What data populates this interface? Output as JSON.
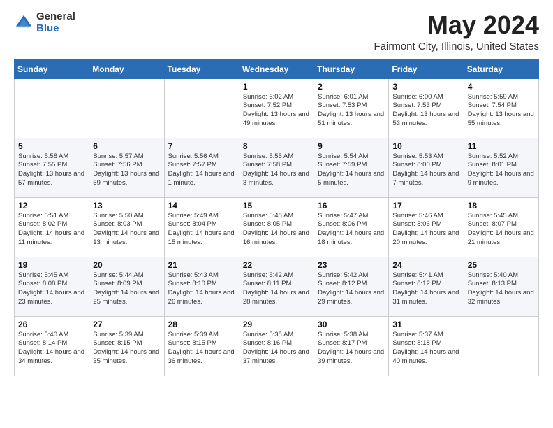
{
  "header": {
    "logo_general": "General",
    "logo_blue": "Blue",
    "title": "May 2024",
    "subtitle": "Fairmont City, Illinois, United States"
  },
  "days_of_week": [
    "Sunday",
    "Monday",
    "Tuesday",
    "Wednesday",
    "Thursday",
    "Friday",
    "Saturday"
  ],
  "weeks": [
    [
      {
        "day": "",
        "sunrise": "",
        "sunset": "",
        "daylight": ""
      },
      {
        "day": "",
        "sunrise": "",
        "sunset": "",
        "daylight": ""
      },
      {
        "day": "",
        "sunrise": "",
        "sunset": "",
        "daylight": ""
      },
      {
        "day": "1",
        "sunrise": "Sunrise: 6:02 AM",
        "sunset": "Sunset: 7:52 PM",
        "daylight": "Daylight: 13 hours and 49 minutes."
      },
      {
        "day": "2",
        "sunrise": "Sunrise: 6:01 AM",
        "sunset": "Sunset: 7:53 PM",
        "daylight": "Daylight: 13 hours and 51 minutes."
      },
      {
        "day": "3",
        "sunrise": "Sunrise: 6:00 AM",
        "sunset": "Sunset: 7:53 PM",
        "daylight": "Daylight: 13 hours and 53 minutes."
      },
      {
        "day": "4",
        "sunrise": "Sunrise: 5:59 AM",
        "sunset": "Sunset: 7:54 PM",
        "daylight": "Daylight: 13 hours and 55 minutes."
      }
    ],
    [
      {
        "day": "5",
        "sunrise": "Sunrise: 5:58 AM",
        "sunset": "Sunset: 7:55 PM",
        "daylight": "Daylight: 13 hours and 57 minutes."
      },
      {
        "day": "6",
        "sunrise": "Sunrise: 5:57 AM",
        "sunset": "Sunset: 7:56 PM",
        "daylight": "Daylight: 13 hours and 59 minutes."
      },
      {
        "day": "7",
        "sunrise": "Sunrise: 5:56 AM",
        "sunset": "Sunset: 7:57 PM",
        "daylight": "Daylight: 14 hours and 1 minute."
      },
      {
        "day": "8",
        "sunrise": "Sunrise: 5:55 AM",
        "sunset": "Sunset: 7:58 PM",
        "daylight": "Daylight: 14 hours and 3 minutes."
      },
      {
        "day": "9",
        "sunrise": "Sunrise: 5:54 AM",
        "sunset": "Sunset: 7:59 PM",
        "daylight": "Daylight: 14 hours and 5 minutes."
      },
      {
        "day": "10",
        "sunrise": "Sunrise: 5:53 AM",
        "sunset": "Sunset: 8:00 PM",
        "daylight": "Daylight: 14 hours and 7 minutes."
      },
      {
        "day": "11",
        "sunrise": "Sunrise: 5:52 AM",
        "sunset": "Sunset: 8:01 PM",
        "daylight": "Daylight: 14 hours and 9 minutes."
      }
    ],
    [
      {
        "day": "12",
        "sunrise": "Sunrise: 5:51 AM",
        "sunset": "Sunset: 8:02 PM",
        "daylight": "Daylight: 14 hours and 11 minutes."
      },
      {
        "day": "13",
        "sunrise": "Sunrise: 5:50 AM",
        "sunset": "Sunset: 8:03 PM",
        "daylight": "Daylight: 14 hours and 13 minutes."
      },
      {
        "day": "14",
        "sunrise": "Sunrise: 5:49 AM",
        "sunset": "Sunset: 8:04 PM",
        "daylight": "Daylight: 14 hours and 15 minutes."
      },
      {
        "day": "15",
        "sunrise": "Sunrise: 5:48 AM",
        "sunset": "Sunset: 8:05 PM",
        "daylight": "Daylight: 14 hours and 16 minutes."
      },
      {
        "day": "16",
        "sunrise": "Sunrise: 5:47 AM",
        "sunset": "Sunset: 8:06 PM",
        "daylight": "Daylight: 14 hours and 18 minutes."
      },
      {
        "day": "17",
        "sunrise": "Sunrise: 5:46 AM",
        "sunset": "Sunset: 8:06 PM",
        "daylight": "Daylight: 14 hours and 20 minutes."
      },
      {
        "day": "18",
        "sunrise": "Sunrise: 5:45 AM",
        "sunset": "Sunset: 8:07 PM",
        "daylight": "Daylight: 14 hours and 21 minutes."
      }
    ],
    [
      {
        "day": "19",
        "sunrise": "Sunrise: 5:45 AM",
        "sunset": "Sunset: 8:08 PM",
        "daylight": "Daylight: 14 hours and 23 minutes."
      },
      {
        "day": "20",
        "sunrise": "Sunrise: 5:44 AM",
        "sunset": "Sunset: 8:09 PM",
        "daylight": "Daylight: 14 hours and 25 minutes."
      },
      {
        "day": "21",
        "sunrise": "Sunrise: 5:43 AM",
        "sunset": "Sunset: 8:10 PM",
        "daylight": "Daylight: 14 hours and 26 minutes."
      },
      {
        "day": "22",
        "sunrise": "Sunrise: 5:42 AM",
        "sunset": "Sunset: 8:11 PM",
        "daylight": "Daylight: 14 hours and 28 minutes."
      },
      {
        "day": "23",
        "sunrise": "Sunrise: 5:42 AM",
        "sunset": "Sunset: 8:12 PM",
        "daylight": "Daylight: 14 hours and 29 minutes."
      },
      {
        "day": "24",
        "sunrise": "Sunrise: 5:41 AM",
        "sunset": "Sunset: 8:12 PM",
        "daylight": "Daylight: 14 hours and 31 minutes."
      },
      {
        "day": "25",
        "sunrise": "Sunrise: 5:40 AM",
        "sunset": "Sunset: 8:13 PM",
        "daylight": "Daylight: 14 hours and 32 minutes."
      }
    ],
    [
      {
        "day": "26",
        "sunrise": "Sunrise: 5:40 AM",
        "sunset": "Sunset: 8:14 PM",
        "daylight": "Daylight: 14 hours and 34 minutes."
      },
      {
        "day": "27",
        "sunrise": "Sunrise: 5:39 AM",
        "sunset": "Sunset: 8:15 PM",
        "daylight": "Daylight: 14 hours and 35 minutes."
      },
      {
        "day": "28",
        "sunrise": "Sunrise: 5:39 AM",
        "sunset": "Sunset: 8:15 PM",
        "daylight": "Daylight: 14 hours and 36 minutes."
      },
      {
        "day": "29",
        "sunrise": "Sunrise: 5:38 AM",
        "sunset": "Sunset: 8:16 PM",
        "daylight": "Daylight: 14 hours and 37 minutes."
      },
      {
        "day": "30",
        "sunrise": "Sunrise: 5:38 AM",
        "sunset": "Sunset: 8:17 PM",
        "daylight": "Daylight: 14 hours and 39 minutes."
      },
      {
        "day": "31",
        "sunrise": "Sunrise: 5:37 AM",
        "sunset": "Sunset: 8:18 PM",
        "daylight": "Daylight: 14 hours and 40 minutes."
      },
      {
        "day": "",
        "sunrise": "",
        "sunset": "",
        "daylight": ""
      }
    ]
  ]
}
